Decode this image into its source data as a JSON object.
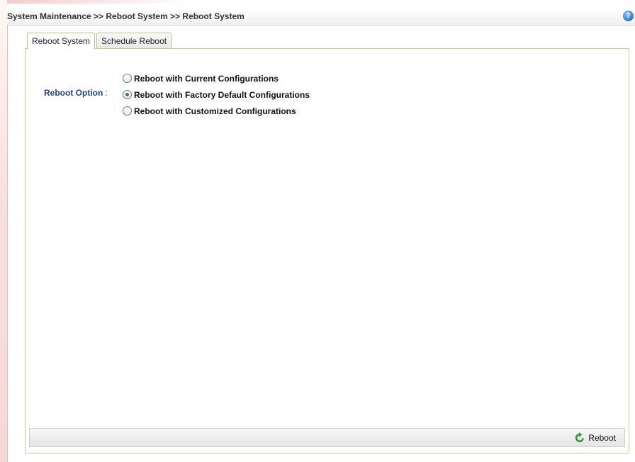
{
  "header": {
    "breadcrumb": "System Maintenance >> Reboot System >> Reboot System",
    "help_icon": "help-icon"
  },
  "tabs": [
    {
      "label": "Reboot System",
      "active": true
    },
    {
      "label": "Schedule Reboot",
      "active": false
    }
  ],
  "form": {
    "option_label": "Reboot Option",
    "option_colon": ":",
    "options": [
      {
        "label": "Reboot with Current Configurations",
        "selected": false
      },
      {
        "label": "Reboot with Factory Default Configurations",
        "selected": true
      },
      {
        "label": "Reboot with Customized Configurations",
        "selected": false
      }
    ]
  },
  "footer": {
    "reboot_label": "Reboot",
    "reboot_icon": "refresh-icon"
  },
  "colors": {
    "label_blue": "#1f3f8f",
    "panel_border": "#d7c48f",
    "icon_green": "#2f9a2f",
    "accent_red_strip": "#f8d6d6"
  }
}
